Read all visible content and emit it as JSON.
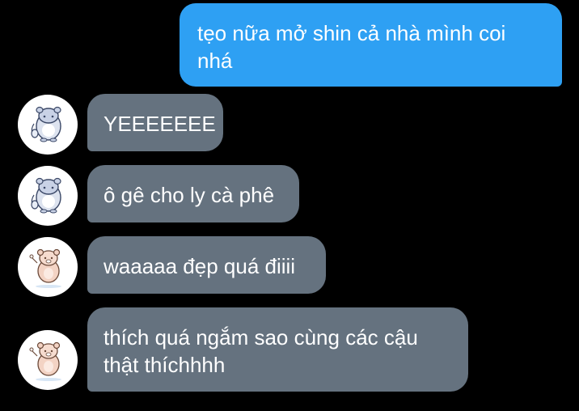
{
  "messages": [
    {
      "id": "m1",
      "sender": "self",
      "text": "tẹo nữa mở shin cả nhà mình coi nhá"
    },
    {
      "id": "m2",
      "sender": "hamster",
      "text": "YEEEEEEE"
    },
    {
      "id": "m3",
      "sender": "hamster",
      "text": "ô gê cho ly cà phê"
    },
    {
      "id": "m4",
      "sender": "bear",
      "text": "waaaaa đẹp quá điiii"
    },
    {
      "id": "m5",
      "sender": "bear",
      "text": "thích quá ngắm sao cùng các cậu thật thíchhhh"
    }
  ],
  "avatars": {
    "hamster": "hamster-sticker-icon",
    "bear": "bear-sticker-icon"
  },
  "colors": {
    "background": "#000000",
    "outgoing_bubble": "#2ea0f3",
    "incoming_bubble": "#65727f",
    "text": "#ffffff"
  }
}
